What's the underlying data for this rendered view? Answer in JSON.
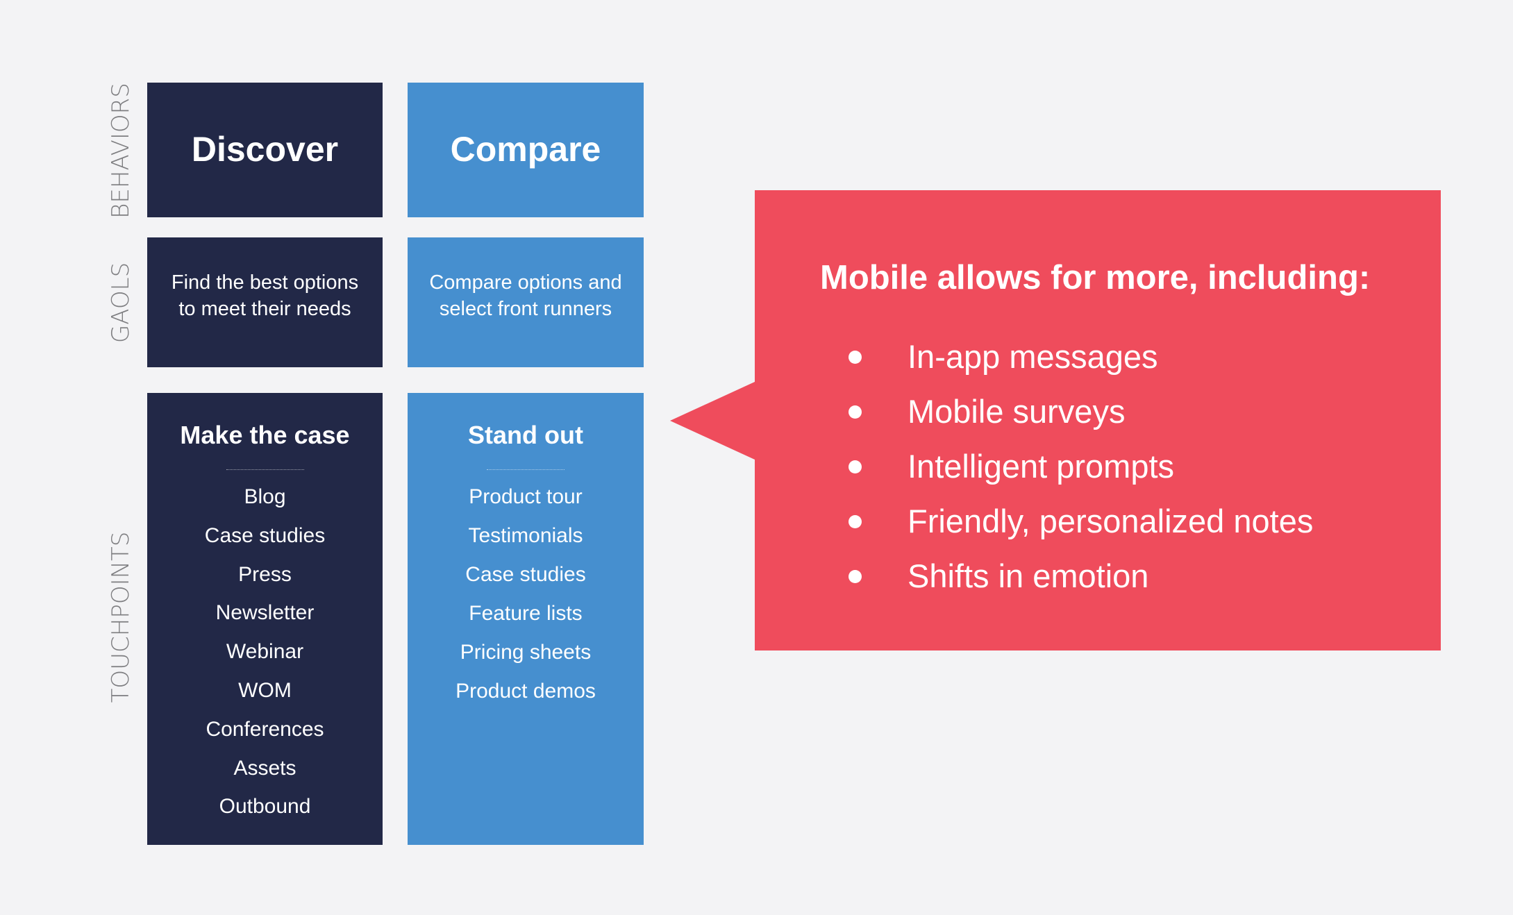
{
  "row_labels": {
    "behaviors": "BEHAVIORS",
    "goals": "GAOLS",
    "touchpoints": "TOUCHPOINTS"
  },
  "columns": [
    {
      "behavior": "Discover",
      "goal": "Find the best options to meet their needs",
      "goal_lines": [
        "Find the best options",
        "to meet their needs"
      ],
      "touchpoint_heading": "Make the case",
      "touchpoints": [
        "Blog",
        "Case studies",
        "Press",
        "Newsletter",
        "Webinar",
        "WOM",
        "Conferences",
        "Assets",
        "Outbound"
      ]
    },
    {
      "behavior": "Compare",
      "goal": "Compare options and select front runners",
      "goal_lines": [
        "Compare options and",
        "select front runners"
      ],
      "touchpoint_heading": "Stand out",
      "touchpoints": [
        "Product tour",
        "Testimonials",
        "Case studies",
        "Feature lists",
        "Pricing sheets",
        "Product demos"
      ]
    }
  ],
  "callout": {
    "title": "Mobile allows for more, including:",
    "items": [
      "In-app messages",
      "Mobile surveys",
      "Intelligent prompts",
      "Friendly, personalized notes",
      "Shifts in emotion"
    ]
  },
  "colors": {
    "background": "#f3f3f5",
    "discover_navy": "#222847",
    "compare_blue": "#468fcf",
    "callout_red": "#ef4c5c",
    "label_grey": "#7d7d80"
  }
}
